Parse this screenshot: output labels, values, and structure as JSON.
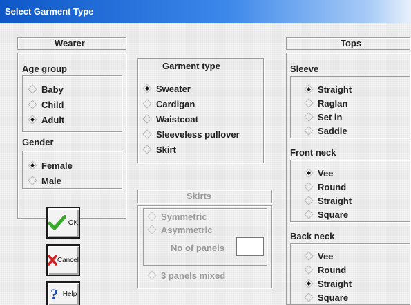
{
  "window": {
    "title": "Select Garment Type"
  },
  "wearer": {
    "header": "Wearer",
    "age_group": {
      "label": "Age group",
      "options": [
        "Baby",
        "Child",
        "Adult"
      ],
      "selected": "Adult"
    },
    "gender": {
      "label": "Gender",
      "options": [
        "Female",
        "Male"
      ],
      "selected": "Female"
    }
  },
  "garment": {
    "label": "Garment type",
    "options": [
      "Sweater",
      "Cardigan",
      "Waistcoat",
      "Sleeveless pullover",
      "Skirt"
    ],
    "selected": "Sweater"
  },
  "skirts": {
    "header": "Skirts",
    "options": [
      "Symmetric",
      "Asymmetric"
    ],
    "no_of_panels_label": "No of panels",
    "no_of_panels_value": "",
    "mixed_label": "3 panels mixed"
  },
  "tops": {
    "header": "Tops",
    "sleeve": {
      "label": "Sleeve",
      "options": [
        "Straight",
        "Raglan",
        "Set in",
        "Saddle"
      ],
      "selected": "Straight"
    },
    "front_neck": {
      "label": "Front neck",
      "options": [
        "Vee",
        "Round",
        "Straight",
        "Square"
      ],
      "selected": "Vee"
    },
    "back_neck": {
      "label": "Back neck",
      "options": [
        "Vee",
        "Round",
        "Straight",
        "Square"
      ],
      "selected": "Straight"
    }
  },
  "buttons": {
    "ok": "OK",
    "cancel": "Cancel",
    "help": "Help"
  },
  "colors": {
    "title_start": "#0e57c8",
    "ok_check": "#3aa82b",
    "cancel_x": "#d21f1f",
    "help_q": "#1a4fc4"
  }
}
